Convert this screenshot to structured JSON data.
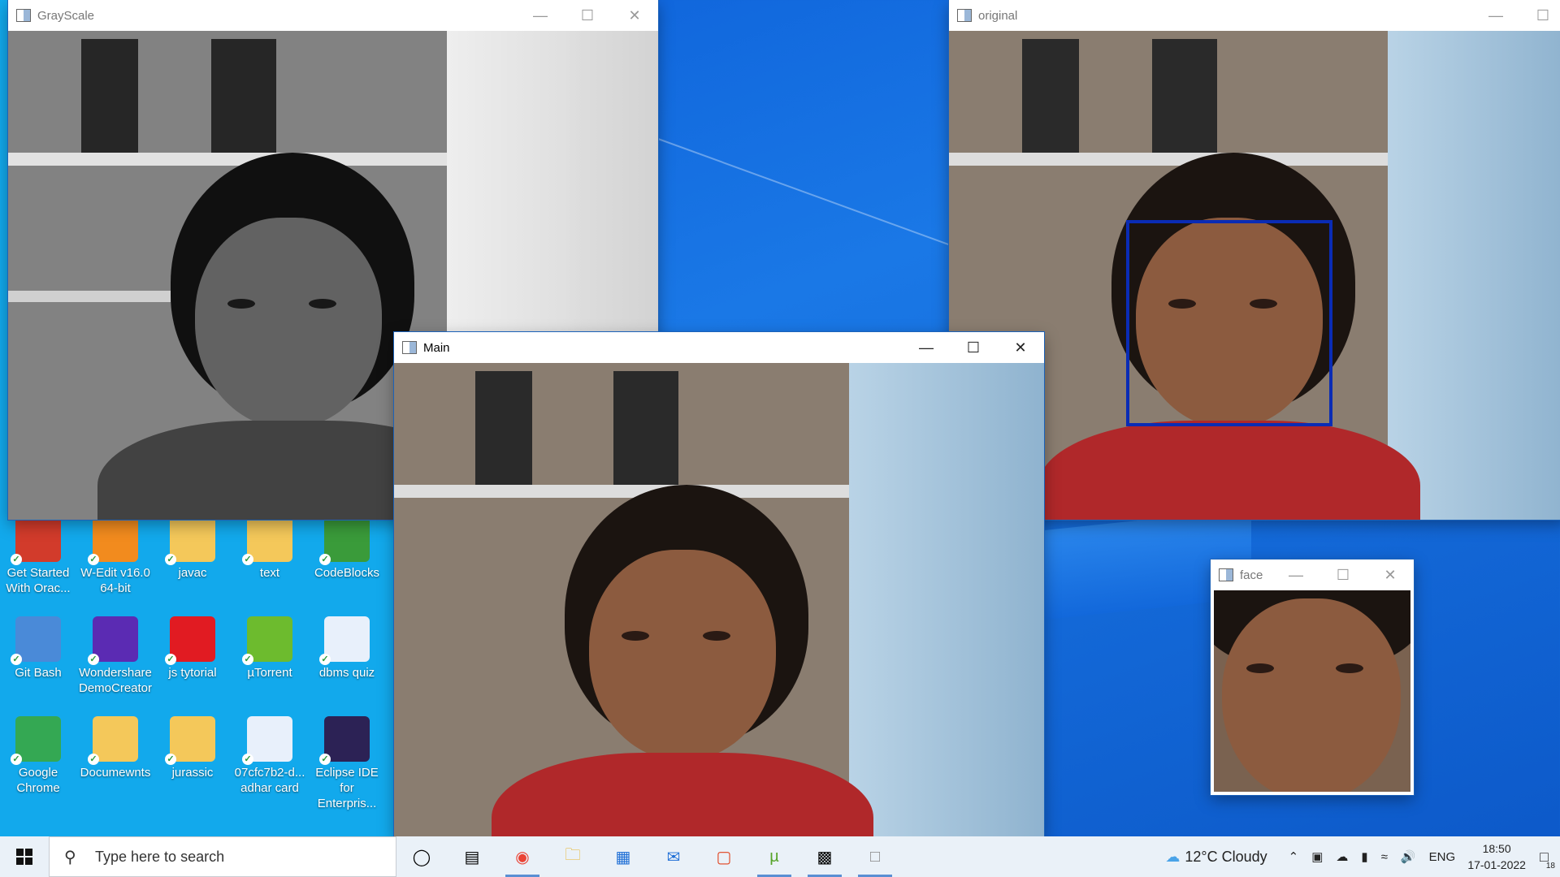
{
  "desktop": {
    "icons": [
      {
        "label": "Get Started\nWith Orac...",
        "icon": "oracle-xe-icon",
        "color": "#d23b2b"
      },
      {
        "label": "W-Edit v16.0\n64-bit",
        "icon": "wedit-icon",
        "color": "#f28b1e"
      },
      {
        "label": "javac",
        "icon": "folder-icon",
        "color": "#f4c85a"
      },
      {
        "label": "text",
        "icon": "folder-icon",
        "color": "#f4c85a"
      },
      {
        "label": "CodeBlocks",
        "icon": "codeblocks-icon",
        "color": "#3a9b3a"
      },
      {
        "label": "Git Bash",
        "icon": "git-bash-icon",
        "color": "#4a8ad8"
      },
      {
        "label": "Wondershare\nDemoCreator",
        "icon": "democreator-icon",
        "color": "#5b2bb3"
      },
      {
        "label": "js tytorial",
        "icon": "opera-file-icon",
        "color": "#e11b22"
      },
      {
        "label": "µTorrent",
        "icon": "utorrent-icon",
        "color": "#6dbb2e"
      },
      {
        "label": "dbms quiz",
        "icon": "edge-document-icon",
        "color": "#e8f0fb"
      },
      {
        "label": "Google\nChrome",
        "icon": "chrome-icon",
        "color": "#34a853"
      },
      {
        "label": "Documewnts",
        "icon": "folder-icon",
        "color": "#f4c85a"
      },
      {
        "label": "jurassic",
        "icon": "folder-icon",
        "color": "#f4c85a"
      },
      {
        "label": "07cfc7b2-d...\nadhar card",
        "icon": "edge-document-icon",
        "color": "#e8f0fb"
      },
      {
        "label": "Eclipse IDE\nfor Enterpris...",
        "icon": "eclipse-icon",
        "color": "#2c2255"
      }
    ]
  },
  "windows": {
    "grayscale": {
      "title": "GrayScale"
    },
    "original": {
      "title": "original"
    },
    "main": {
      "title": "Main"
    },
    "face": {
      "title": "face"
    }
  },
  "taskbar": {
    "search_placeholder": "Type here to search",
    "apps": [
      "cortana-icon",
      "task-view-icon",
      "chrome-icon",
      "file-explorer-icon",
      "store-icon",
      "mail-icon",
      "office-icon",
      "utorrent-icon",
      "terminal-icon",
      "notepad-icon"
    ],
    "weather": "12°C  Cloudy",
    "language": "ENG",
    "time": "18:50",
    "date": "17-01-2022",
    "notifications": "18"
  }
}
